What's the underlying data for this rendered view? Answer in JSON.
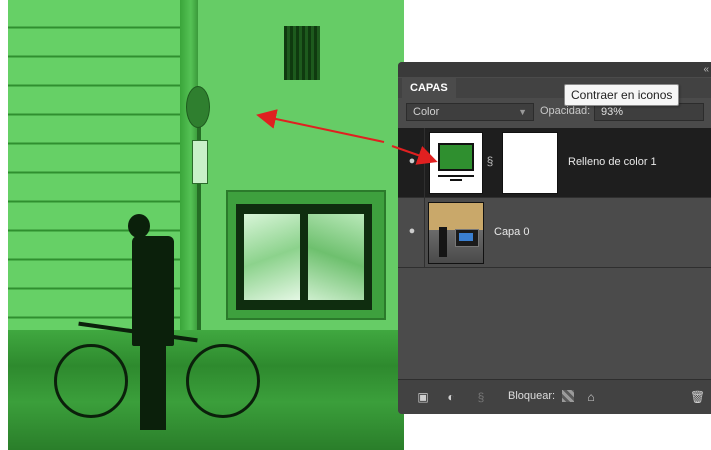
{
  "panel": {
    "title": "CAPAS",
    "collapse_glyph": "«",
    "blend_mode": "Color",
    "opacity_label": "Opacidad:",
    "opacity_value": "93%",
    "layers": [
      {
        "name": "Relleno de color 1",
        "type": "fill-layer",
        "visible": true,
        "selected": true,
        "fill_color": "#2f8f2f"
      },
      {
        "name": "Capa 0",
        "type": "image-layer",
        "visible": true,
        "selected": false
      }
    ],
    "lock_label": "Bloquear:"
  },
  "tooltip": {
    "text": "Contraer en iconos"
  },
  "icons": {
    "eye": "eye-icon",
    "chain": "link-chain-icon",
    "new_layer": "new-layer-icon",
    "adjustment": "adjustment-layer-icon",
    "link": "link-layers-icon",
    "lock_transparent": "lock-transparent-pixels-icon",
    "lock_all": "lock-all-icon",
    "trash": "trash-icon",
    "blend_caret": "chevron-down-icon"
  },
  "colors": {
    "annotation_arrow": "#e02020",
    "canvas_tint": "#5fc85f",
    "panel_bg": "#4b4b4b",
    "selected_row": "#1e1e1e"
  }
}
